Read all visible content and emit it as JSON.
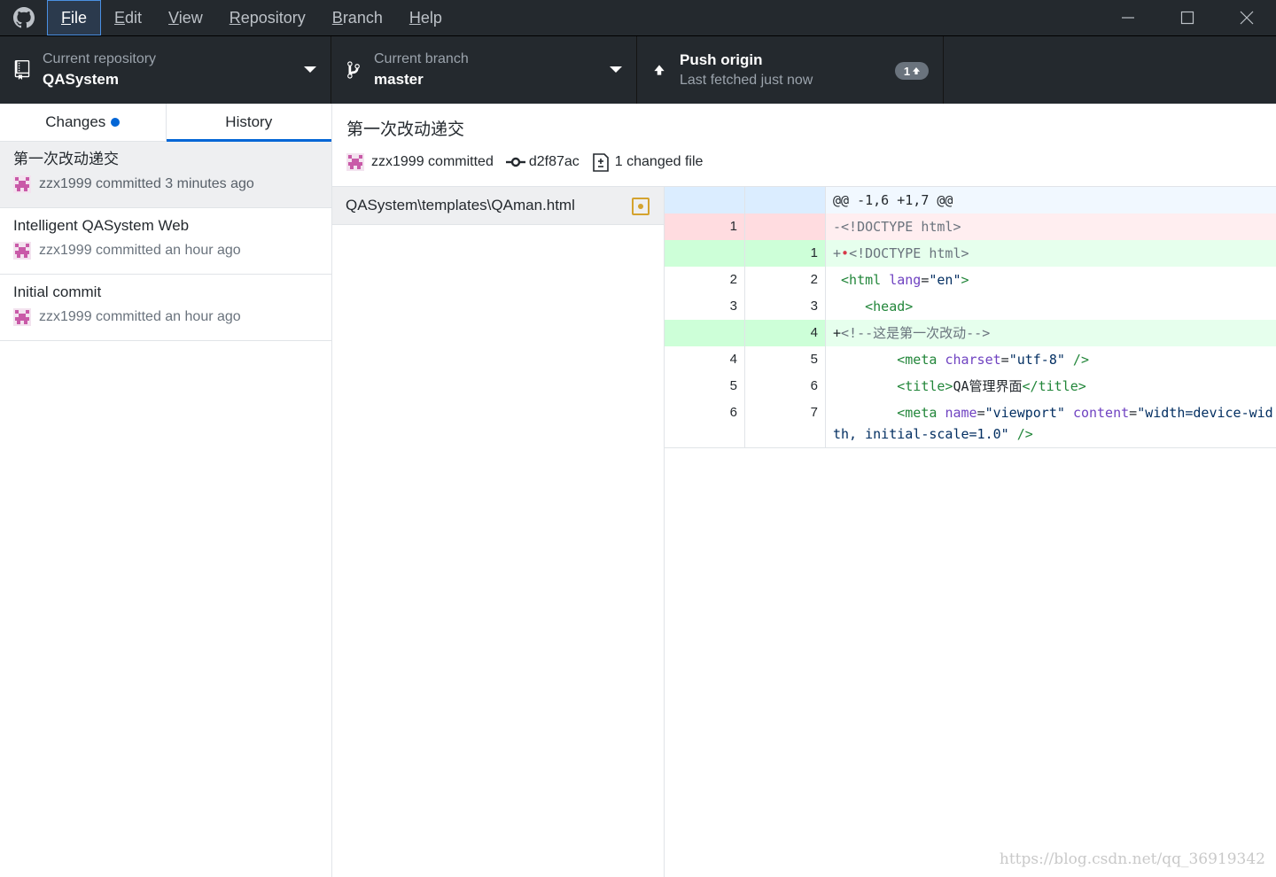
{
  "menu": {
    "items": [
      {
        "label": "File",
        "accel": "F",
        "rest": "ile"
      },
      {
        "label": "Edit",
        "accel": "E",
        "rest": "dit"
      },
      {
        "label": "View",
        "accel": "V",
        "rest": "iew"
      },
      {
        "label": "Repository",
        "accel": "R",
        "rest": "epository"
      },
      {
        "label": "Branch",
        "accel": "B",
        "rest": "ranch"
      },
      {
        "label": "Help",
        "accel": "H",
        "rest": "elp"
      }
    ]
  },
  "toolbar": {
    "repo_label": "Current repository",
    "repo_value": "QASystem",
    "branch_label": "Current branch",
    "branch_value": "master",
    "push_label": "Push origin",
    "push_sub": "Last fetched just now",
    "push_badge": "1"
  },
  "tabs": {
    "changes": "Changes",
    "history": "History"
  },
  "commits": [
    {
      "title": "第一次改动递交",
      "meta": "zzx1999 committed 3 minutes ago"
    },
    {
      "title": "Intelligent QASystem Web",
      "meta": "zzx1999 committed an hour ago"
    },
    {
      "title": "Initial commit",
      "meta": "zzx1999 committed an hour ago"
    }
  ],
  "commit_detail": {
    "title": "第一次改动递交",
    "author": "zzx1999 committed",
    "sha": "d2f87ac",
    "files_changed": "1 changed file"
  },
  "files": [
    {
      "path": "QASystem\\templates\\QAman.html",
      "status": "modified"
    }
  ],
  "diff": {
    "hunk": "@@ -1,6 +1,7 @@",
    "lines": [
      {
        "old": "1",
        "new": "",
        "type": "del"
      },
      {
        "old": "",
        "new": "1",
        "type": "add"
      },
      {
        "old": "2",
        "new": "2",
        "type": "ctx"
      },
      {
        "old": "3",
        "new": "3",
        "type": "ctx"
      },
      {
        "old": "",
        "new": "4",
        "type": "add"
      },
      {
        "old": "4",
        "new": "5",
        "type": "ctx"
      },
      {
        "old": "5",
        "new": "6",
        "type": "ctx"
      },
      {
        "old": "6",
        "new": "7",
        "type": "ctx"
      }
    ],
    "code": {
      "l1": "-<!DOCTYPE html>",
      "l2_prefix": "+",
      "l2_dot": "•",
      "l2": "<!DOCTYPE html>",
      "l3_tag_open": " <html ",
      "l3_attr": "lang",
      "l3_eq": "=",
      "l3_val": "\"en\"",
      "l3_close": ">",
      "l4": "    <head>",
      "l5_prefix": "+",
      "l5": "<!--这是第一次改动-->",
      "l6_tag": "        <meta ",
      "l6_attr": "charset",
      "l6_eq": "=",
      "l6_val": "\"utf-8\"",
      "l6_close": " />",
      "l7_tag": "        <title>",
      "l7_text": "QA管理界面",
      "l7_close": "</title>",
      "l8_tag": "        <meta ",
      "l8_attr1": "name",
      "l8_eq1": "=",
      "l8_val1": "\"viewport\"",
      "l8_attr2": "content",
      "l8_eq2": "=",
      "l8_val2": "\"width=device-width, initial-scale=1.0\"",
      "l8_close": " />"
    }
  },
  "watermark": "https://blog.csdn.net/qq_36919342"
}
